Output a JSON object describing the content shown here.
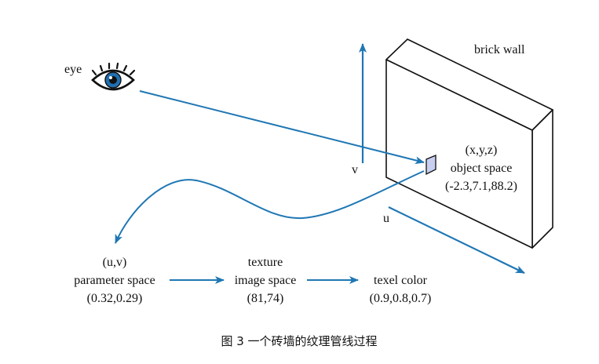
{
  "labels": {
    "eye": "eye",
    "brick_wall": "brick wall",
    "v_axis": "v",
    "u_axis": "u"
  },
  "object_space": {
    "coords_label": "(x,y,z)",
    "name": "object space",
    "value": "(-2.3,7.1,88.2)"
  },
  "parameter_space": {
    "coords_label": "(u,v)",
    "name": "parameter space",
    "value": "(0.32,0.29)"
  },
  "texture_image_space": {
    "name_line1": "texture",
    "name_line2": "image space",
    "value": "(81,74)"
  },
  "texel_color": {
    "name": "texel color",
    "value": "(0.9,0.8,0.7)"
  },
  "caption": "图 3 一个砖墙的纹理管线过程",
  "colors": {
    "arrow": "#1f77b4",
    "outline": "#111111",
    "patch_fill": "#c8cff0"
  },
  "icons": {
    "eye": "eye-icon",
    "patch": "surface-patch-icon"
  }
}
